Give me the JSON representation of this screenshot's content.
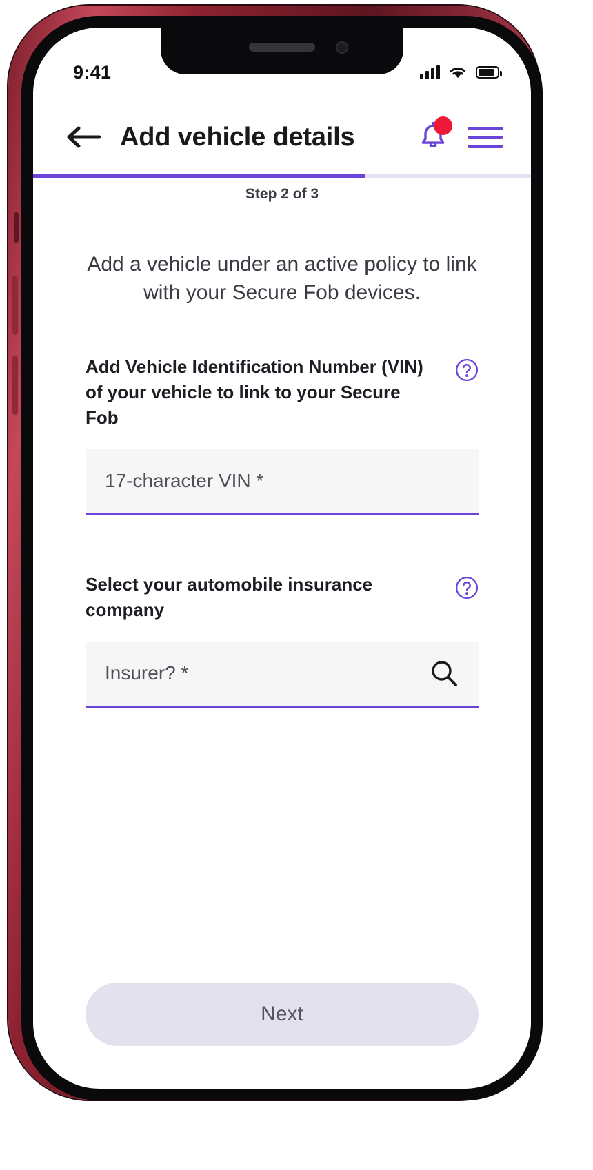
{
  "device": {
    "frame_color": "#8e2231",
    "screen_bg": "#ffffff"
  },
  "theme": {
    "accent": "#6b44d9",
    "accent_light": "#e6e2f2",
    "notification_dot": "#ee1837",
    "input_bg": "#f6f6f7",
    "disabled_button_bg": "#e4e1ef",
    "disabled_button_text": "#555560"
  },
  "status_bar": {
    "time": "9:41",
    "cellular_icon": "signal-bars-icon",
    "wifi_icon": "wifi-icon",
    "battery_icon": "battery-icon"
  },
  "header": {
    "back_icon": "arrow-left-icon",
    "title": "Add vehicle details",
    "notification_icon": "bell-icon",
    "notification_badge": "",
    "menu_icon": "hamburger-menu-icon"
  },
  "progress": {
    "step_text": "Step 2 of 3",
    "current_step": 2,
    "total_steps": 3,
    "percent": 66.6
  },
  "main": {
    "intro_text": "Add a vehicle under an active policy to link with your Secure Fob devices.",
    "fields": [
      {
        "label": "Add Vehicle Identification Number (VIN) of your vehicle to link to your Secure Fob",
        "help_icon": "question-mark-circle-icon",
        "placeholder": "17-character VIN *",
        "value": "",
        "trailing_icon": ""
      },
      {
        "label": "Select your automobile insurance company",
        "help_icon": "question-mark-circle-icon",
        "placeholder": "Insurer? *",
        "value": "",
        "trailing_icon": "search-icon"
      }
    ]
  },
  "footer": {
    "next_label": "Next",
    "next_enabled": false
  }
}
